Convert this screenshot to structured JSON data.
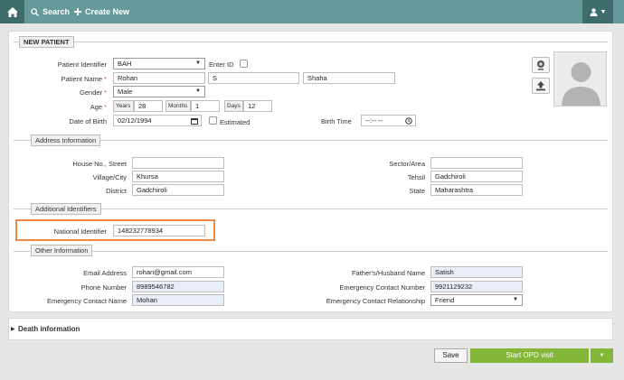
{
  "nav": {
    "search": "Search",
    "create_new": "Create New"
  },
  "sections": {
    "new_patient": "NEW PATIENT",
    "address": "Address Information",
    "additional": "Additional Identifiers",
    "other": "Other Information",
    "death": "Death information"
  },
  "patient": {
    "identifier_label": "Patient Identifier",
    "identifier_value": "BAH",
    "enter_id_label": "Enter ID",
    "name_label": "Patient Name",
    "first_name": "Rohan",
    "middle_name": "S",
    "last_name": "Shaha",
    "gender_label": "Gender",
    "gender_value": "Male",
    "age_label": "Age",
    "years_unit": "Years",
    "years_value": "28",
    "months_unit": "Months",
    "months_value": "1",
    "days_unit": "Days",
    "days_value": "12",
    "dob_label": "Date of Birth",
    "dob_value": "02/12/1994",
    "estimated_label": "Estimated",
    "birth_time_label": "Birth Time",
    "birth_time_value": "--:-- --"
  },
  "address": {
    "house_label": "House No., Street",
    "house_value": "",
    "sector_label": "Sector/Area",
    "sector_value": "",
    "village_label": "Village/City",
    "village_value": "Khursa",
    "tehsil_label": "Tehsil",
    "tehsil_value": "Gadchiroli",
    "district_label": "District",
    "district_value": "Gadchiroli",
    "state_label": "State",
    "state_value": "Maharashtra"
  },
  "identifiers": {
    "national_label": "National Identifier",
    "national_value": "148232778934"
  },
  "other": {
    "email_label": "Email Address",
    "email_value": "rohan@gmail.com",
    "father_label": "Father's/Husband Name",
    "father_value": "Satish",
    "phone_label": "Phone Number",
    "phone_value": "8989546782",
    "emergency_number_label": "Emergency Contact Number",
    "emergency_number_value": "9921129232",
    "emergency_name_label": "Emergency Contact Name",
    "emergency_name_value": "Mohan",
    "relationship_label": "Emergency Contact Relationship",
    "relationship_value": "Friend"
  },
  "actions": {
    "save": "Save",
    "start_opd": "Start OPD visit"
  },
  "colors": {
    "topbar": "#669999",
    "topbar_dark": "#3e6b6b",
    "primary_green": "#84b63a",
    "highlight": "#f0883e",
    "required": "#d9534f"
  },
  "icons": [
    "home-icon",
    "search-icon",
    "plus-icon",
    "user-icon",
    "webcam-icon",
    "upload-icon",
    "caret-down-icon",
    "calendar-icon",
    "clock-icon"
  ]
}
